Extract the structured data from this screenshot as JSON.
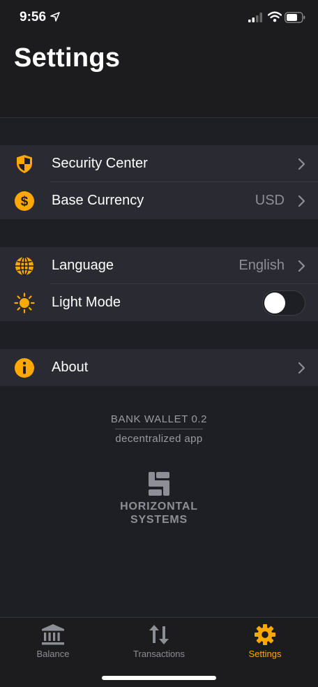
{
  "status": {
    "time": "9:56"
  },
  "header": {
    "title": "Settings"
  },
  "groups": [
    {
      "rows": [
        {
          "label": "Security Center",
          "icon": "shield-icon"
        },
        {
          "label": "Base Currency",
          "value": "USD",
          "icon": "dollar-icon"
        }
      ]
    },
    {
      "rows": [
        {
          "label": "Language",
          "value": "English",
          "icon": "globe-icon"
        },
        {
          "label": "Light Mode",
          "icon": "sun-icon",
          "toggle_on": false
        }
      ]
    },
    {
      "rows": [
        {
          "label": "About",
          "icon": "info-icon"
        }
      ]
    }
  ],
  "footer": {
    "version": "BANK WALLET 0.2",
    "subtitle": "decentralized app",
    "company_line1": "HORIZONTAL",
    "company_line2": "SYSTEMS"
  },
  "tabs": [
    {
      "label": "Balance",
      "icon": "bank-icon",
      "active": false
    },
    {
      "label": "Transactions",
      "icon": "transfer-arrows-icon",
      "active": false
    },
    {
      "label": "Settings",
      "icon": "gear-icon",
      "active": true
    }
  ],
  "colors": {
    "accent": "#ffa800",
    "background": "#1e1f24",
    "row_background": "#2a2b32",
    "secondary_text": "#8e8f96"
  }
}
